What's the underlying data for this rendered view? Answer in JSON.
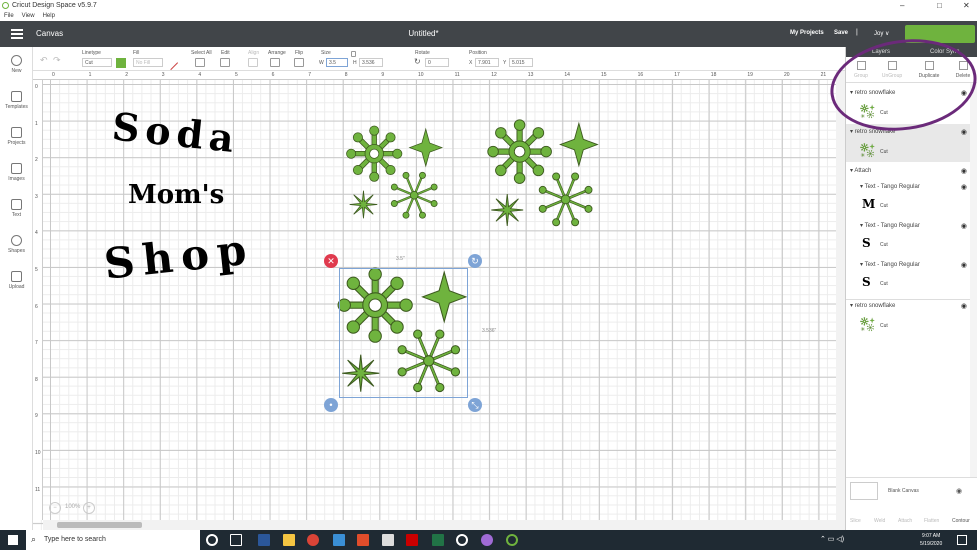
{
  "window": {
    "title": "Cricut Design Space  v5.9.7",
    "controls": [
      "–",
      "□",
      "✕"
    ]
  },
  "menu": [
    "File",
    "View",
    "Help"
  ],
  "header": {
    "section": "Canvas",
    "doc_title": "Untitled*",
    "my_projects": "My Projects",
    "save": "Save",
    "separator": "|",
    "user": "Joy",
    "user_caret": "∨"
  },
  "toolbar": {
    "linetype_label": "Linetype",
    "linetype_value": "Cut",
    "fill_label": "Fill",
    "fill_value": "No Fill",
    "select_all": "Select All",
    "edit": "Edit",
    "align": "Align",
    "arrange": "Arrange",
    "flip": "Flip",
    "size_label": "Size",
    "w_label": "W",
    "w_value": "3.5",
    "h_label": "H",
    "h_value": "3.536",
    "rotate_label": "Rotate",
    "rotate_value": "0",
    "position_label": "Position",
    "x_label": "X",
    "x_value": "7.901",
    "y_label": "Y",
    "y_value": "5.015"
  },
  "left_nav": [
    {
      "label": "New",
      "icon": "plus-icon"
    },
    {
      "label": "Templates",
      "icon": "shirt-icon"
    },
    {
      "label": "Projects",
      "icon": "projects-icon"
    },
    {
      "label": "Images",
      "icon": "images-icon"
    },
    {
      "label": "Text",
      "icon": "text-icon"
    },
    {
      "label": "Shapes",
      "icon": "shapes-icon"
    },
    {
      "label": "Upload",
      "icon": "upload-icon"
    }
  ],
  "ruler": {
    "top": [
      "0",
      "1",
      "2",
      "3",
      "4",
      "5",
      "6",
      "7",
      "8",
      "9",
      "10",
      "11",
      "12",
      "13",
      "14",
      "15",
      "16",
      "17",
      "18",
      "19",
      "20",
      "21"
    ],
    "left": [
      "0",
      "1",
      "2",
      "3",
      "4",
      "5",
      "6",
      "7",
      "8",
      "9",
      "10",
      "11"
    ]
  },
  "canvas": {
    "design_text": {
      "line1": "Soda",
      "line2": "Mom's",
      "line3": "Shop"
    },
    "selection": {
      "width_label": "3.5\"",
      "height_label": "3.536\""
    },
    "zoom": "100%",
    "accent": "#6fb33e"
  },
  "panel": {
    "tabs": [
      "Layers",
      "Color Sync"
    ],
    "actions": [
      "Group",
      "UnGroup",
      "Duplicate",
      "Delete"
    ],
    "layers": [
      {
        "name": "retro snowflake",
        "item": "Cut",
        "thumb": "snowflake"
      },
      {
        "name": "retro snowflake",
        "item": "Cut",
        "thumb": "snowflake"
      },
      {
        "name": "Attach",
        "item": "",
        "thumb": ""
      },
      {
        "name": "Text - Tango Regular",
        "item": "Cut",
        "thumb": "M"
      },
      {
        "name": "Text - Tango Regular",
        "item": "Cut",
        "thumb": "S"
      },
      {
        "name": "Text - Tango Regular",
        "item": "Cut",
        "thumb": "S"
      },
      {
        "name": "retro snowflake",
        "item": "Cut",
        "thumb": "snowflake"
      }
    ],
    "blank_canvas": "Blank Canvas",
    "bottom_actions": [
      "Slice",
      "Weld",
      "Attach",
      "Flatten",
      "Contour"
    ]
  },
  "taskbar": {
    "search_placeholder": "Type here to search",
    "time": "9:07 AM",
    "date": "5/19/2020"
  },
  "annotation_color": "#6b2a7a"
}
